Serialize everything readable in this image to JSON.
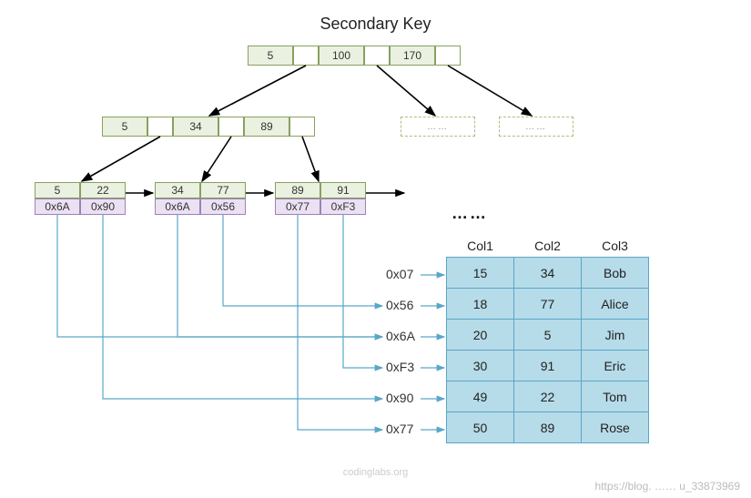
{
  "title": "Secondary Key",
  "root": {
    "keys": [
      "5",
      "100",
      "170"
    ]
  },
  "level1_left": {
    "keys": [
      "5",
      "34",
      "89"
    ]
  },
  "level1_placeholder": "……",
  "leaves": [
    {
      "keys": [
        "5",
        "22"
      ],
      "ptrs": [
        "0x6A",
        "0x90"
      ]
    },
    {
      "keys": [
        "34",
        "77"
      ],
      "ptrs": [
        "0x6A",
        "0x56"
      ]
    },
    {
      "keys": [
        "89",
        "91"
      ],
      "ptrs": [
        "0x77",
        "0xF3"
      ]
    }
  ],
  "leaf_continuation": "……",
  "table": {
    "headers": [
      "Col1",
      "Col2",
      "Col3"
    ],
    "row_addrs": [
      "0x07",
      "0x56",
      "0x6A",
      "0xF3",
      "0x90",
      "0x77"
    ],
    "rows": [
      [
        "15",
        "34",
        "Bob"
      ],
      [
        "18",
        "77",
        "Alice"
      ],
      [
        "20",
        "5",
        "Jim"
      ],
      [
        "30",
        "91",
        "Eric"
      ],
      [
        "49",
        "22",
        "Tom"
      ],
      [
        "50",
        "89",
        "Rose"
      ]
    ]
  },
  "watermark_center": "codinglabs.org",
  "watermark_right": "https://blog. …… u_33873969"
}
